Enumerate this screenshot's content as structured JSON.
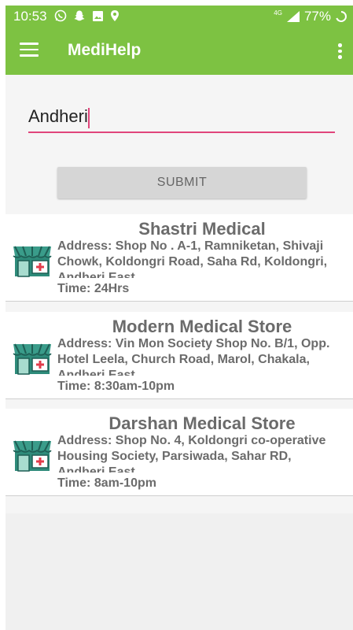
{
  "status_bar": {
    "time": "10:53",
    "network": "4G",
    "battery": "77%",
    "icons": [
      "whatsapp-icon",
      "snapchat-icon",
      "image-icon",
      "location-icon",
      "signal-icon",
      "sync-icon"
    ]
  },
  "app_bar": {
    "title": "MediHelp",
    "menu_icon": "hamburger-menu-icon",
    "overflow_icon": "more-vert-icon",
    "color": "#7dc242"
  },
  "search": {
    "value": "Andheri",
    "underline_color": "#e0457b"
  },
  "submit_label": "SUBMIT",
  "stores": [
    {
      "name": "Shastri Medical",
      "address": "Address: Shop No . A-1, Ramniketan, Shivaji Chowk, Koldongri Road, Saha Rd, Koldongri, Andheri East",
      "time": "Time: 24Hrs"
    },
    {
      "name": "Modern Medical Store",
      "address": "Address: Vin Mon Society Shop No. B/1, Opp. Hotel Leela, Church Road, Marol, Chakala, Andheri East",
      "time": "Time: 8:30am-10pm"
    },
    {
      "name": "Darshan Medical Store",
      "address": "Address: Shop No. 4, Koldongri co-operative Housing Society, Parsiwada, Sahar RD, Andheri East",
      "time": "Time: 8am-10pm"
    }
  ]
}
